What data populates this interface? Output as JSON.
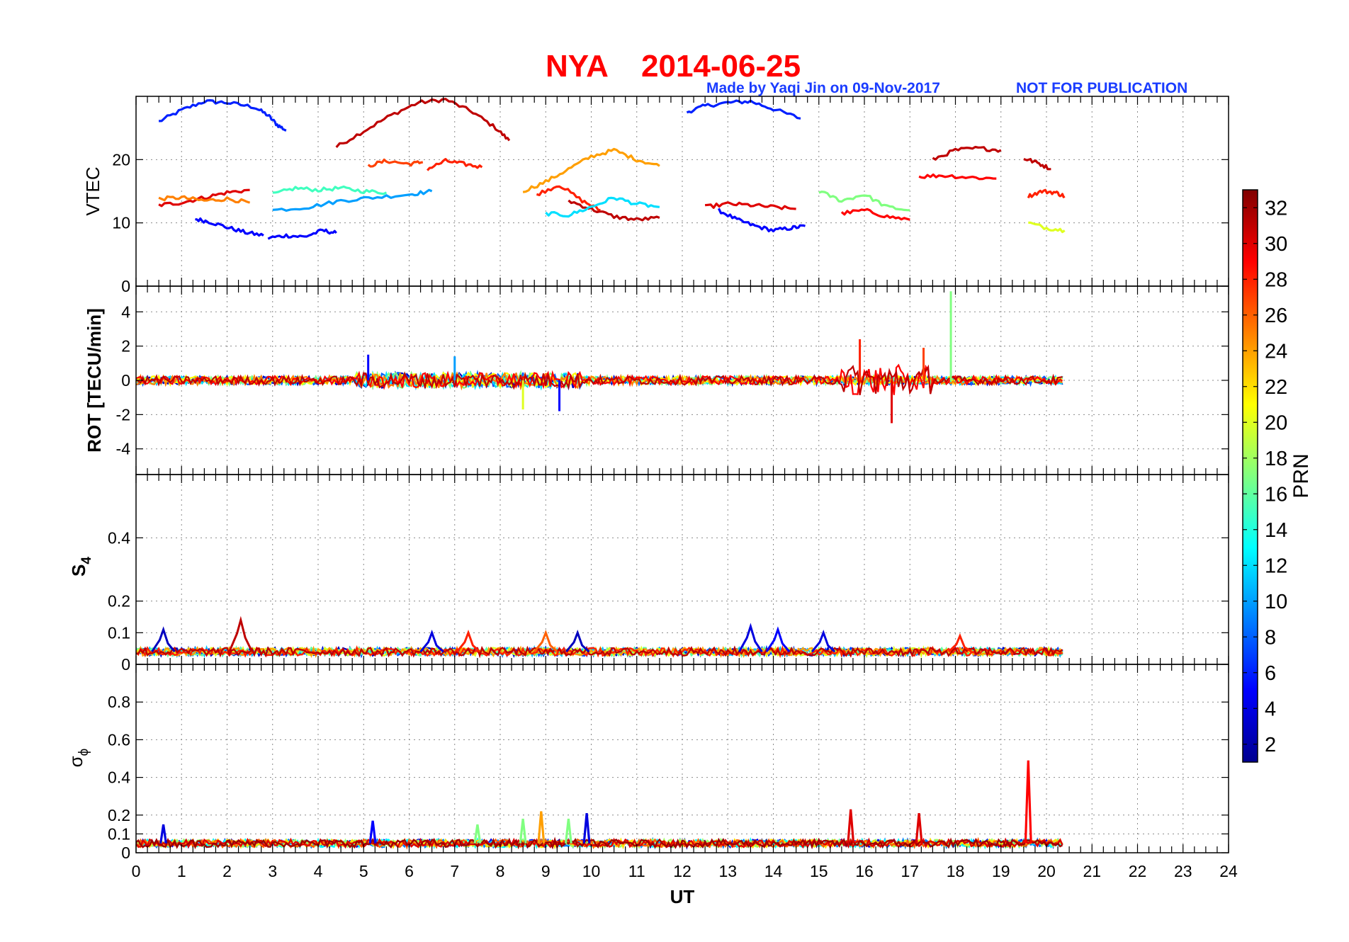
{
  "title_station": "NYA",
  "title_date": "2014-06-25",
  "credit_left": "Made by Yaqi Jin on 09-Nov-2017",
  "credit_right": "NOT FOR PUBLICATION",
  "colorbar": {
    "label": "PRN",
    "ticks": [
      "2",
      "4",
      "6",
      "8",
      "10",
      "12",
      "14",
      "16",
      "18",
      "20",
      "22",
      "24",
      "26",
      "28",
      "30",
      "32"
    ],
    "range": [
      1,
      33
    ],
    "colormap": "jet"
  },
  "x_axis": {
    "label": "UT",
    "range": [
      0,
      24
    ],
    "ticks": [
      "0",
      "1",
      "2",
      "3",
      "4",
      "5",
      "6",
      "7",
      "8",
      "9",
      "10",
      "11",
      "12",
      "13",
      "14",
      "15",
      "16",
      "17",
      "18",
      "19",
      "20",
      "21",
      "22",
      "23",
      "24"
    ]
  },
  "panels": {
    "vtec": {
      "ylabel": "VTEC",
      "ylim": [
        0,
        30
      ],
      "ticks": [
        "0",
        "10",
        "20"
      ]
    },
    "rot": {
      "ylabel": "ROT [TECU/min]",
      "ylim": [
        -5.5,
        5.5
      ],
      "ticks": [
        "-4",
        "-2",
        "0",
        "2",
        "4"
      ]
    },
    "s4": {
      "ylabel_main": "S",
      "ylabel_sub": "4",
      "ylim": [
        0,
        0.6
      ],
      "ticks": [
        "0",
        "0.1",
        "0.2",
        "0.4"
      ]
    },
    "sigphi": {
      "ylabel_main": "σ",
      "ylabel_sub": "ϕ",
      "ylim": [
        0,
        1
      ],
      "ticks": [
        "0",
        "0.1",
        "0.2",
        "0.4",
        "0.6",
        "0.8"
      ]
    }
  },
  "chart_data": [
    {
      "type": "line",
      "panel": "VTEC",
      "ylabel": "VTEC",
      "xlim": [
        0,
        24
      ],
      "ylim": [
        0,
        30
      ],
      "grid": true,
      "series": [
        {
          "prn": 6,
          "x": [
            0.5,
            1.0,
            1.5,
            2.0,
            2.6,
            2.9,
            3.1,
            3.3
          ],
          "y": [
            26,
            27.8,
            29.2,
            29,
            28.3,
            27,
            25.5,
            24.6
          ]
        },
        {
          "prn": 31,
          "x": [
            4.4,
            5.0,
            5.6,
            6.2,
            6.8,
            7.4,
            7.9,
            8.2
          ],
          "y": [
            22,
            24.5,
            27,
            29,
            29.5,
            27.5,
            25,
            23
          ]
        },
        {
          "prn": 6,
          "x": [
            12.1,
            12.5,
            13.0,
            13.5,
            14.0,
            14.6
          ],
          "y": [
            27.5,
            28.5,
            29,
            29.2,
            28,
            26.5
          ]
        },
        {
          "prn": 5,
          "x": [
            1.3,
            1.6,
            2.0,
            2.4,
            2.8
          ],
          "y": [
            10.6,
            10.2,
            9.3,
            8.5,
            8.0
          ]
        },
        {
          "prn": 5,
          "x": [
            2.9,
            3.3,
            3.7,
            4.1,
            4.4
          ],
          "y": [
            7.6,
            8.0,
            7.8,
            8.8,
            8.4
          ]
        },
        {
          "prn": 5,
          "x": [
            12.8,
            13.2,
            13.6,
            14.0,
            14.4,
            14.7
          ],
          "y": [
            12,
            10.5,
            9.5,
            8.8,
            9.2,
            9.5
          ]
        },
        {
          "prn": 30,
          "x": [
            0.5,
            1.0,
            1.5,
            2.0,
            2.5
          ],
          "y": [
            12.8,
            13.2,
            14.0,
            14.8,
            15.2
          ]
        },
        {
          "prn": 25,
          "x": [
            0.5,
            1.0,
            1.5,
            2.0,
            2.5
          ],
          "y": [
            13.8,
            14.0,
            13.5,
            13.8,
            13.2
          ]
        },
        {
          "prn": 15,
          "x": [
            3.0,
            3.5,
            4.0,
            4.5,
            5.0,
            5.5
          ],
          "y": [
            14.5,
            15.5,
            15.2,
            15.5,
            15.0,
            14.8
          ]
        },
        {
          "prn": 10,
          "x": [
            3.0,
            3.8,
            4.5,
            5.2,
            6.0,
            6.5
          ],
          "y": [
            12.0,
            12.5,
            13.5,
            14.0,
            14.5,
            15.0
          ]
        },
        {
          "prn": 27,
          "x": [
            5.1,
            5.5,
            6.0,
            6.3
          ],
          "y": [
            19.0,
            19.8,
            19.3,
            19.6
          ]
        },
        {
          "prn": 28,
          "x": [
            6.4,
            6.8,
            7.2,
            7.6
          ],
          "y": [
            18.5,
            19.8,
            19.3,
            18.8
          ]
        },
        {
          "prn": 24,
          "x": [
            8.5,
            9.0,
            9.5,
            10.0,
            10.5,
            11.0,
            11.5
          ],
          "y": [
            15.0,
            16.5,
            18.5,
            20.5,
            21.5,
            20.0,
            19.0
          ]
        },
        {
          "prn": 28,
          "x": [
            8.8,
            9.3,
            9.8,
            10.2
          ],
          "y": [
            14.5,
            16.0,
            13.5,
            12.0
          ]
        },
        {
          "prn": 31,
          "x": [
            9.5,
            10.0,
            10.5,
            11.0,
            11.5
          ],
          "y": [
            13.5,
            12.2,
            11.0,
            10.5,
            10.8
          ]
        },
        {
          "prn": 12,
          "x": [
            9.0,
            9.5,
            10.0,
            10.5,
            11.0,
            11.5
          ],
          "y": [
            11.5,
            11.2,
            12.5,
            14.0,
            13.0,
            12.5
          ]
        },
        {
          "prn": 30,
          "x": [
            12.5,
            13.0,
            13.5,
            14.0,
            14.5
          ],
          "y": [
            12.5,
            13.0,
            12.8,
            12.5,
            12.2
          ]
        },
        {
          "prn": 17,
          "x": [
            15.0,
            15.5,
            16.0,
            16.5,
            17.0
          ],
          "y": [
            15.0,
            13.5,
            14.5,
            12.5,
            12.0
          ]
        },
        {
          "prn": 29,
          "x": [
            15.5,
            16.0,
            16.5,
            17.0
          ],
          "y": [
            11.5,
            12.0,
            11.0,
            10.5
          ]
        },
        {
          "prn": 31,
          "x": [
            17.5,
            18.0,
            18.5,
            19.0
          ],
          "y": [
            20.0,
            21.5,
            21.8,
            21.5
          ]
        },
        {
          "prn": 29,
          "x": [
            17.2,
            17.7,
            18.3,
            18.9
          ],
          "y": [
            17.3,
            17.5,
            17.2,
            17.0
          ]
        },
        {
          "prn": 31,
          "x": [
            19.5,
            19.8,
            20.1
          ],
          "y": [
            20.2,
            19.5,
            18.5
          ]
        },
        {
          "prn": 28,
          "x": [
            19.6,
            19.9,
            20.2,
            20.4
          ],
          "y": [
            14.2,
            15.0,
            14.8,
            14.2
          ]
        },
        {
          "prn": 20,
          "x": [
            19.6,
            20.0,
            20.4
          ],
          "y": [
            10.0,
            9.2,
            8.8
          ]
        }
      ]
    },
    {
      "type": "line",
      "panel": "ROT",
      "ylabel": "ROT [TECU/min]",
      "xlim": [
        0,
        24
      ],
      "ylim": [
        -5.5,
        5.5
      ],
      "grid": true,
      "note_values": "fluctuations around 0 for UT 0 to 20.4; notable spikes",
      "spikes": [
        {
          "prn": 17,
          "x": 17.9,
          "y": 5.2
        },
        {
          "prn": 28,
          "x": 15.9,
          "y": 2.4
        },
        {
          "prn": 30,
          "x": 16.6,
          "y": -2.5
        },
        {
          "prn": 27,
          "x": 17.3,
          "y": 1.9
        },
        {
          "prn": 5,
          "x": 9.3,
          "y": -1.8
        },
        {
          "prn": 20,
          "x": 8.5,
          "y": -1.7
        },
        {
          "prn": 5,
          "x": 5.1,
          "y": 1.5
        },
        {
          "prn": 10,
          "x": 7.0,
          "y": 1.4
        }
      ]
    },
    {
      "type": "line",
      "panel": "S4",
      "ylabel": "S4",
      "xlim": [
        0,
        24
      ],
      "ylim": [
        0,
        0.6
      ],
      "grid": true,
      "baseline": 0.04,
      "peaks": [
        {
          "prn": 3,
          "x": 0.6,
          "y": 0.11
        },
        {
          "prn": 31,
          "x": 2.3,
          "y": 0.14
        },
        {
          "prn": 4,
          "x": 6.5,
          "y": 0.1
        },
        {
          "prn": 28,
          "x": 7.3,
          "y": 0.1
        },
        {
          "prn": 26,
          "x": 9.0,
          "y": 0.1
        },
        {
          "prn": 3,
          "x": 9.7,
          "y": 0.1
        },
        {
          "prn": 4,
          "x": 13.5,
          "y": 0.12
        },
        {
          "prn": 5,
          "x": 14.1,
          "y": 0.11
        },
        {
          "prn": 4,
          "x": 15.1,
          "y": 0.1
        },
        {
          "prn": 28,
          "x": 18.1,
          "y": 0.09
        }
      ]
    },
    {
      "type": "line",
      "panel": "sigma_phi",
      "ylabel": "σϕ",
      "xlim": [
        0,
        24
      ],
      "ylim": [
        0,
        1
      ],
      "grid": true,
      "baseline": 0.05,
      "peaks": [
        {
          "prn": 29,
          "x": 19.6,
          "y": 0.49
        },
        {
          "prn": 30,
          "x": 15.7,
          "y": 0.23
        },
        {
          "prn": 30,
          "x": 17.2,
          "y": 0.21
        },
        {
          "prn": 24,
          "x": 8.9,
          "y": 0.22
        },
        {
          "prn": 4,
          "x": 9.9,
          "y": 0.21
        },
        {
          "prn": 17,
          "x": 8.5,
          "y": 0.18
        },
        {
          "prn": 17,
          "x": 9.5,
          "y": 0.18
        },
        {
          "prn": 5,
          "x": 5.2,
          "y": 0.17
        },
        {
          "prn": 4,
          "x": 0.6,
          "y": 0.15
        },
        {
          "prn": 17,
          "x": 7.5,
          "y": 0.15
        }
      ]
    }
  ]
}
